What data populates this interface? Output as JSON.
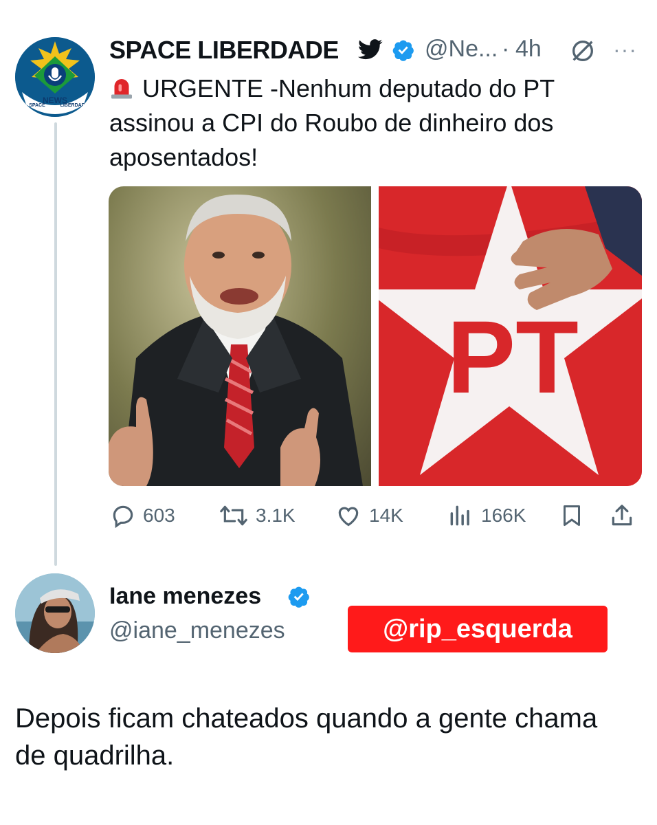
{
  "tweet": {
    "author_name": "SPACE LIBERDADE",
    "author_handle": "@Ne...",
    "separator": "·",
    "time": "4h",
    "more": "···",
    "text": "URGENTE -Nenhum deputado do PT assinou a CPI do Roubo de dinheiro dos aposentados!",
    "avatar": {
      "logo_texts": [
        "NEWS",
        "SPACE",
        "LIBERDADE"
      ]
    },
    "flag_text": "PT",
    "stats": {
      "replies": "603",
      "retweets": "3.1K",
      "likes": "14K",
      "views": "166K"
    },
    "icons": [
      "bird-icon",
      "verified-icon",
      "edited-icon",
      "reply-icon",
      "retweet-icon",
      "like-icon",
      "views-icon",
      "bookmark-icon",
      "share-icon",
      "siren-icon"
    ]
  },
  "reply": {
    "author_name": "Iane menezes",
    "author_handle": "@iane_menezes",
    "text": "Depois ficam chateados quando a gente chama de quadrilha."
  },
  "watermark": {
    "text": "@rip_esquerda"
  },
  "colors": {
    "verified": "#1d9bf0",
    "muted": "#536471",
    "watermark_bg": "#ff1a1a",
    "flag_red": "#d8272a"
  }
}
